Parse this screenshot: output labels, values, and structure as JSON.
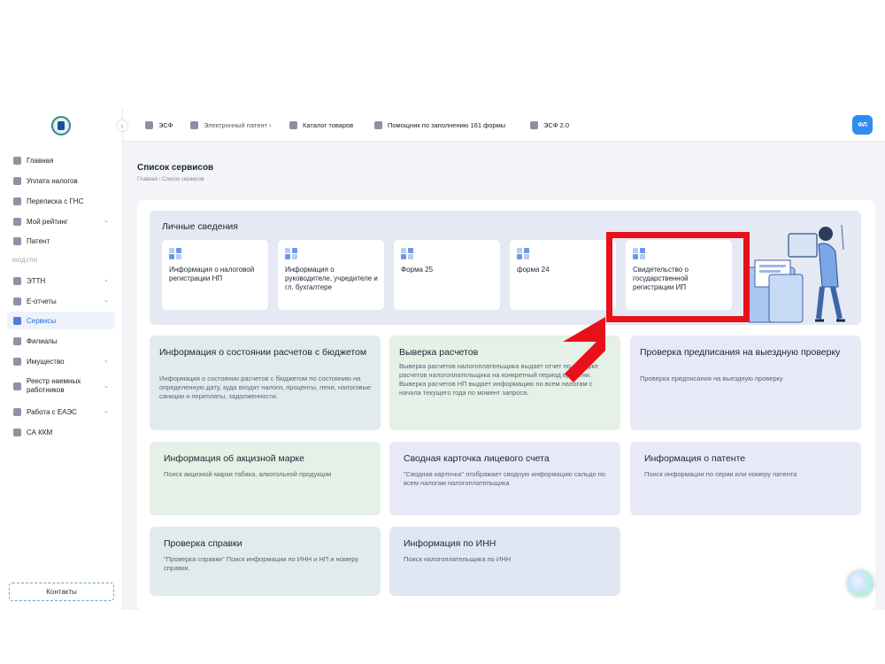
{
  "sidebar": {
    "items": [
      {
        "label": "Главная",
        "icon": "home-icon"
      },
      {
        "label": "Уплата налогов",
        "icon": "payment-icon"
      },
      {
        "label": "Переписка с ГНС",
        "icon": "mail-icon"
      },
      {
        "label": "Мой рейтинг",
        "icon": "rating-icon"
      },
      {
        "label": "Патент",
        "icon": "document-icon"
      }
    ],
    "modules_label": "МОДУЛИ",
    "modules": [
      {
        "label": "ЭТТН",
        "icon": "truck-icon"
      },
      {
        "label": "Е-отчеты",
        "icon": "reports-icon"
      },
      {
        "label": "Сервисы",
        "icon": "services-icon"
      },
      {
        "label": "Филиалы",
        "icon": "branches-icon"
      },
      {
        "label": "Имущество",
        "icon": "property-icon"
      },
      {
        "label": "Реестр наемных работников",
        "icon": "employees-icon"
      },
      {
        "label": "Работа с ЕАЭС",
        "icon": "globe-icon"
      },
      {
        "label": "СА ККМ",
        "icon": "cashbox-icon"
      }
    ],
    "contacts_label": "Контакты"
  },
  "topbar": {
    "items": [
      {
        "label": "ЭСФ"
      },
      {
        "label": "Электронный патент ›"
      },
      {
        "label": "Каталог товаров"
      },
      {
        "label": "Помощник по заполнению 161 формы"
      },
      {
        "label": "ЭСФ 2.0"
      }
    ],
    "avatar": "ФЛ"
  },
  "page": {
    "title": "Список сервисов",
    "breadcrumb": "Главная  ›  Список сервисов"
  },
  "personal": {
    "title": "Личные сведения",
    "cards": [
      {
        "label": "Информация о налоговой регистрации НП"
      },
      {
        "label": "Информация о руководителе, учредителе и гл. бухгалтере"
      },
      {
        "label": "Форма 25"
      },
      {
        "label": "форма 24"
      },
      {
        "label": "Свидетельство о государственной регистрации ИП"
      }
    ]
  },
  "services": [
    {
      "title": "Информация о состоянии расчетов с бюджетом",
      "desc": "Информация о состоянии расчетов с бюджетом по состоянию на определенную дату, куда входят налоги, проценты, пени, налоговые санкции и переплаты, задолженности."
    },
    {
      "title": "Выверка расчетов",
      "desc": "Выверка расчетов налогоплательщика выдает отчет по выверке расчетов налогоплательщика на конкретный период времени. Выверка расчетов НП выдает информацию по всем налогам с начала текущего года по момент запроса."
    },
    {
      "title": "Проверка предписания на выездную проверку",
      "desc": "Проверка предписания на выездную проверку"
    },
    {
      "title": "Информация об акцизной марке",
      "desc": "Поиск акцизной марки табака, алкогольной продукции"
    },
    {
      "title": "Сводная карточка лицевого счета",
      "desc": "\"Сводная карточка\" отображает сводную информацию сальдо по всем налогам налогоплательщика"
    },
    {
      "title": "Информация о патенте",
      "desc": "Поиск информации по серии или номеру патента"
    },
    {
      "title": "Проверка справки",
      "desc": "\"Проверка справки\" Поиск информации по ИНН и НП и номеру справки."
    },
    {
      "title": "Информация по ИНН",
      "desc": "Поиск налогоплательщика по ИНН"
    }
  ],
  "colors": {
    "accent": "#2e8cf0",
    "highlight": "#e8101a"
  }
}
